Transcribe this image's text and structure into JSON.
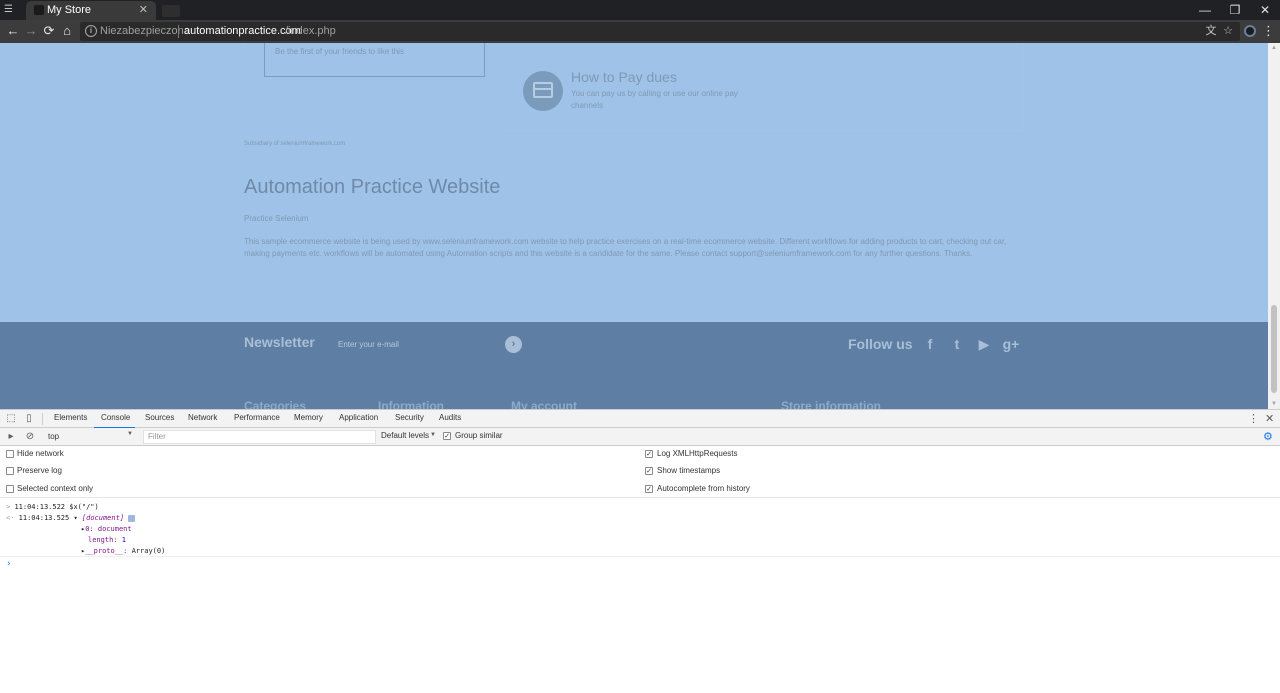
{
  "browser": {
    "tab_title": "My Store",
    "tab_close": "✕",
    "security_label": "Niezabezpieczona",
    "url_host": "automationpractice.com",
    "url_path": "/index.php",
    "window_controls": [
      "—",
      "❐",
      "✕"
    ],
    "nav": {
      "back": "←",
      "forward": "→",
      "reload": "⟳",
      "home": "⌂"
    },
    "omnibox_icons": {
      "translate": "文",
      "bookmark": "☆"
    },
    "menu": "⋮"
  },
  "page": {
    "facebook_text": "Be the first of your friends to like this",
    "pay_title": "How to Pay dues",
    "pay_desc": "You can pay us by calling or use our online pay channels",
    "subsidiary": "Subsidiary of seleniumframework.com",
    "site_title": "Automation Practice Website",
    "site_subtitle": "Practice Selenium",
    "site_description": "This sample ecommerce website is being used by www.seleniumframework.com website to help practice exercises on a real-time ecommerce website. Different workflows for adding products to cart, checking out car, making payments etc. workflows will be automated using Automation scripts and this website is a candidate for the same. Please contact support@seleniumframework.com for any further questions. Thanks.",
    "newsletter_title": "Newsletter",
    "newsletter_placeholder": "Enter your e-mail",
    "newsletter_submit": "›",
    "follow_us": "Follow us",
    "social": {
      "facebook": "f",
      "twitter": "t",
      "youtube": "▶",
      "googleplus": "g+"
    },
    "footer_columns": [
      "Categories",
      "Information",
      "My account",
      "Store information"
    ]
  },
  "devtools": {
    "tabs": [
      "Elements",
      "Console",
      "Sources",
      "Network",
      "Performance",
      "Memory",
      "Application",
      "Security",
      "Audits"
    ],
    "active_tab": "Console",
    "context": "top",
    "filter_placeholder": "Filter",
    "levels": "Default levels",
    "group_similar": "Group similar",
    "settings_left": [
      "Hide network",
      "Preserve log",
      "Selected context only"
    ],
    "settings_right": [
      "Log XMLHttpRequests",
      "Show timestamps",
      "Autocomplete from history"
    ],
    "console_lines": {
      "input_ts": "11:04:13.522",
      "input_cmd": "$x(\"/\")",
      "output_ts": "11:04:13.525",
      "output_head": "[document]",
      "item0_key": "0:",
      "item0_val": "document",
      "length_key": "length:",
      "length_val": "1",
      "proto_key": "__proto__:",
      "proto_val": "Array(0)"
    }
  }
}
